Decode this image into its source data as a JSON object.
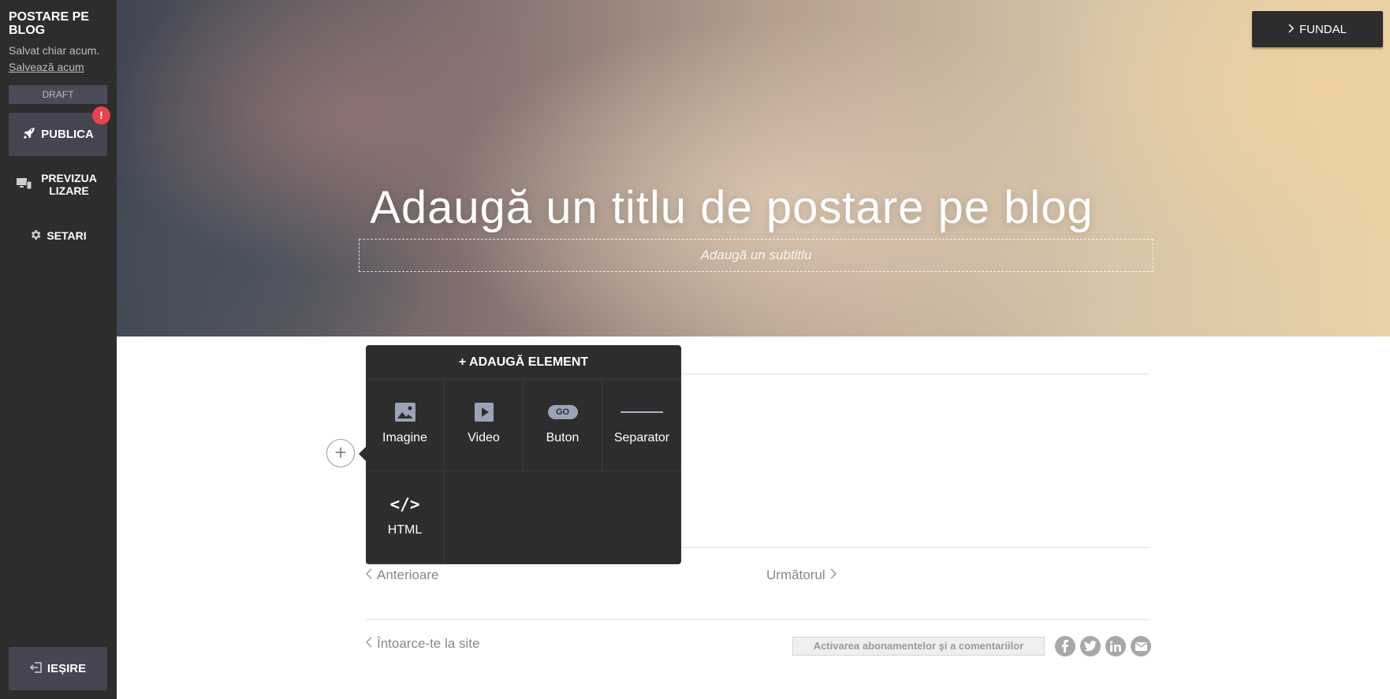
{
  "sidebar": {
    "title": "POSTARE PE BLOG",
    "saved_status": "Salvat chiar acum.",
    "save_now": "Salvează acum",
    "draft": "DRAFT",
    "publish": "PUBLICA",
    "publish_badge": "!",
    "preview": "PREVIZUALIZARE",
    "preview_line1": "PREVIZUA",
    "preview_line2": "LIZARE",
    "settings": "SETARI",
    "exit": "IEȘIRE"
  },
  "hero": {
    "background_button": "FUNDAL",
    "title": "Adaugă un titlu de postare pe blog",
    "subtitle_placeholder": "Adaugă un subtitlu"
  },
  "add_element_menu": {
    "header": "+ ADAUGĂ ELEMENT",
    "items": [
      {
        "label": "Imagine",
        "icon": "image-icon"
      },
      {
        "label": "Video",
        "icon": "video-play-icon"
      },
      {
        "label": "Buton",
        "icon": "button-go-icon",
        "icon_text": "GO"
      },
      {
        "label": "Separator",
        "icon": "separator-line-icon"
      },
      {
        "label": "HTML",
        "icon": "code-icon",
        "icon_text": "</>"
      }
    ]
  },
  "navigation": {
    "previous": "Anterioare",
    "next": "Următorul",
    "back_to_site": "Întoarce-te la site"
  },
  "footer": {
    "subscribe_button": "Activarea abonamentelor și a comentariilor",
    "social": [
      "facebook-icon",
      "twitter-icon",
      "linkedin-icon",
      "email-icon"
    ]
  },
  "colors": {
    "sidebar_bg": "#2d2d2d",
    "button_bg": "#454552",
    "badge": "#e8424b",
    "menu_bg": "#2d2d2d",
    "icon_accent": "#9aa3b8"
  }
}
